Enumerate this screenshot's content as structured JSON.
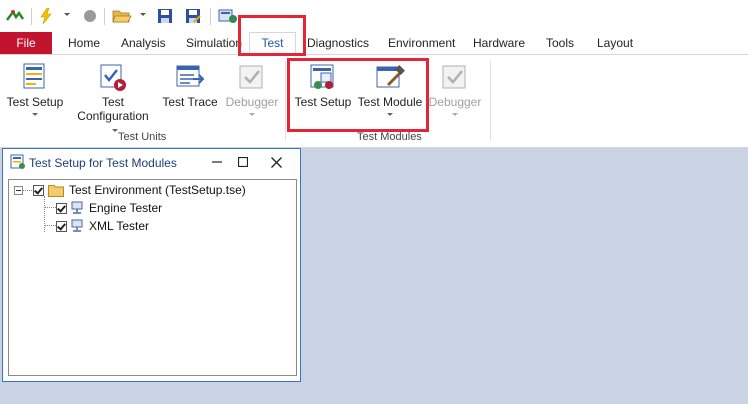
{
  "quick_access": {
    "icons": [
      "app-logo-icon",
      "lightning-icon",
      "record-icon",
      "open-folder-icon",
      "save-icon",
      "save-as-icon",
      "config-icon"
    ]
  },
  "tabs": {
    "file": "File",
    "items": [
      "Home",
      "Analysis",
      "Simulation",
      "Test",
      "Diagnostics",
      "Environment",
      "Hardware",
      "Tools",
      "Layout"
    ],
    "active": "Test"
  },
  "ribbon": {
    "test_units": {
      "label": "Test Units",
      "buttons": {
        "test_setup": "Test Setup",
        "test_configuration_1": "Test",
        "test_configuration_2": "Configuration",
        "test_trace": "Test Trace",
        "debugger": "Debugger"
      }
    },
    "test_modules": {
      "label": "Test Modules",
      "buttons": {
        "test_setup": "Test Setup",
        "test_module": "Test Module",
        "debugger": "Debugger"
      }
    }
  },
  "panel": {
    "title": "Test Setup for Test Modules",
    "tree": {
      "root": "Test Environment  (TestSetup.tse)",
      "children": [
        "Engine Tester",
        "XML Tester"
      ]
    }
  },
  "colors": {
    "file_tab": "#c2142e",
    "highlight": "#e32636",
    "workspace": "#c9d3e3",
    "accent": "#1f55a8"
  }
}
